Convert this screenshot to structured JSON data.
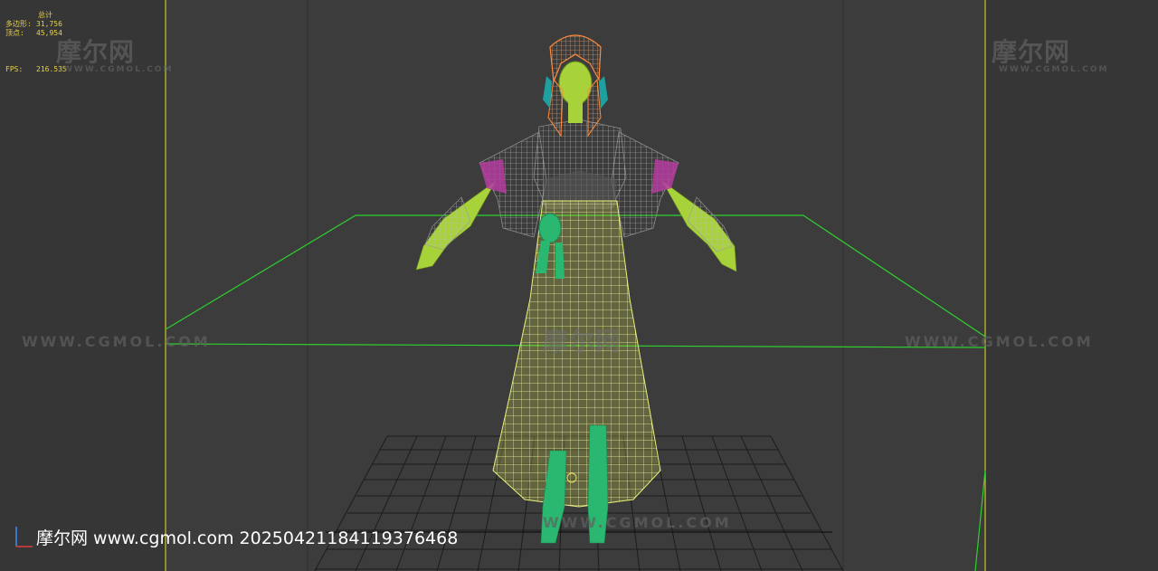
{
  "stats": {
    "title": "总计",
    "polygons_label": "多边形:",
    "polygons_value": "31,756",
    "vertices_label": "顶点:",
    "vertices_value": "45,954",
    "fps_label": "FPS:",
    "fps_value": "216.535"
  },
  "watermarks": {
    "logo": "摩尔网",
    "logo_sub": "WWW.CGMOL.COM",
    "url": "WWW.CGMOL.COM"
  },
  "caption": "摩尔网 www.cgmol.com 20250421184119376468",
  "colors": {
    "background": "#3c3c3c",
    "grid": "#1c1c1c",
    "safe_frame": "#c8c81e",
    "ground_plane": "#2ed12e",
    "hair": "#ff8a3c",
    "skin": "#a8d23a",
    "cloth": "#8c8c8c",
    "skirt": "#e8f07a",
    "sleeve_trim": "#b43ca0",
    "boots": "#2ab870",
    "ribbon": "#1ea0a0"
  },
  "icons": [
    "axis-gizmo-icon"
  ]
}
